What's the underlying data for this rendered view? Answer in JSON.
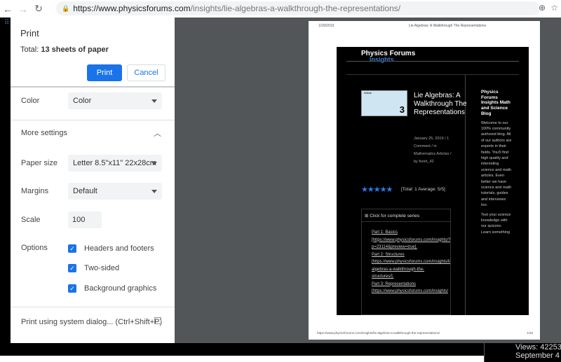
{
  "browser": {
    "url_host": "https://www.physicsforums.com",
    "url_path": "/insights/lie-algebras-a-walkthrough-the-representations/"
  },
  "print": {
    "title": "Print",
    "total_prefix": "Total: ",
    "total_value": "13 sheets of paper",
    "print_label": "Print",
    "cancel_label": "Cancel",
    "color_label": "Color",
    "color_value": "Color",
    "more_settings": "More settings",
    "paper_label": "Paper size",
    "paper_value": "Letter 8.5\"x11\" 22x28cm",
    "margins_label": "Margins",
    "margins_value": "Default",
    "scale_label": "Scale",
    "scale_value": "100",
    "options_label": "Options",
    "options": [
      {
        "label": "Headers and footers",
        "checked": true
      },
      {
        "label": "Two-sided",
        "checked": true
      },
      {
        "label": "Background graphics",
        "checked": true
      }
    ],
    "system_dialog": "Print using system dialog... (Ctrl+Shift+P)"
  },
  "preview": {
    "date": "1/29/2019",
    "header_title": "Lie Algebras: A Walkthrough The Representations",
    "logo": "Physics Forums",
    "logo_sub": "Insights",
    "thumb_label": "Article",
    "thumb_num": "3",
    "article_title": "Lie Algebras: A Walkthrough The Representations",
    "meta": "January 25, 2019 / 1 Comment / in Mathematics Articles / by fresh_42",
    "side_title": "Physics Forums Insights Math and Science Blog",
    "side_p1": "Welcome to our 100% community authored blog. All of our authors are experts in their fields. You'll find high quality and interesting science and math articles. Even better we have science and math tutorials, guides and interviews too.",
    "side_p2": "Test your science knowledge with our quizzes. Learn something",
    "stars": "★★★★★",
    "rating": "[Total: 1    Average: 5/5]",
    "series_head": "Click for complete series",
    "series_links": [
      "Part 1: Basics",
      "[https://www.physicsforums.com/insights/?",
      "p=23114&preview=true].",
      "Part 2: Structures",
      "[https://www.physicsforums.com/insights/lie-",
      "algebras-a-walkthrough-the-",
      "structures/].",
      "Part 3: Representations",
      "[https://www.physicsforums.com/insights/"
    ],
    "footer_url": "https://www.physicsforums.com/insights/lie-algebras-a-walkthrough-the-representations/",
    "page_num": "1/26"
  },
  "background": {
    "views": "Views: 42253",
    "date_partial": "September 4"
  }
}
